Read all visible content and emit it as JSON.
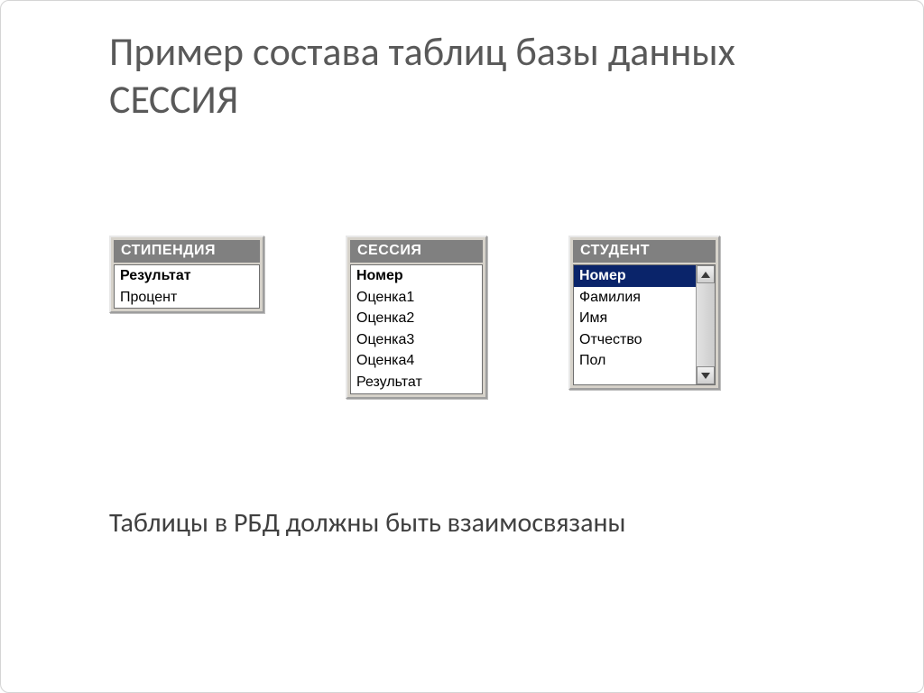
{
  "title": "Пример состава таблиц базы данных СЕССИЯ",
  "tables": [
    {
      "header": "СТИПЕНДИЯ",
      "scroll": false,
      "rows": [
        {
          "label": "Результат",
          "bold": true,
          "selected": false
        },
        {
          "label": "Процент",
          "bold": false,
          "selected": false
        }
      ]
    },
    {
      "header": "СЕССИЯ",
      "scroll": false,
      "rows": [
        {
          "label": "Номер",
          "bold": true,
          "selected": false
        },
        {
          "label": "Оценка1",
          "bold": false,
          "selected": false
        },
        {
          "label": "Оценка2",
          "bold": false,
          "selected": false
        },
        {
          "label": "Оценка3",
          "bold": false,
          "selected": false
        },
        {
          "label": "Оценка4",
          "bold": false,
          "selected": false
        },
        {
          "label": "Результат",
          "bold": false,
          "selected": false
        }
      ]
    },
    {
      "header": "СТУДЕНТ",
      "scroll": true,
      "rows": [
        {
          "label": "Номер",
          "bold": true,
          "selected": true
        },
        {
          "label": "Фамилия",
          "bold": false,
          "selected": false
        },
        {
          "label": "Имя",
          "bold": false,
          "selected": false
        },
        {
          "label": "Отчество",
          "bold": false,
          "selected": false
        },
        {
          "label": "Пол",
          "bold": false,
          "selected": false
        }
      ]
    }
  ],
  "footer": "Таблицы в РБД должны быть взаимосвязаны"
}
